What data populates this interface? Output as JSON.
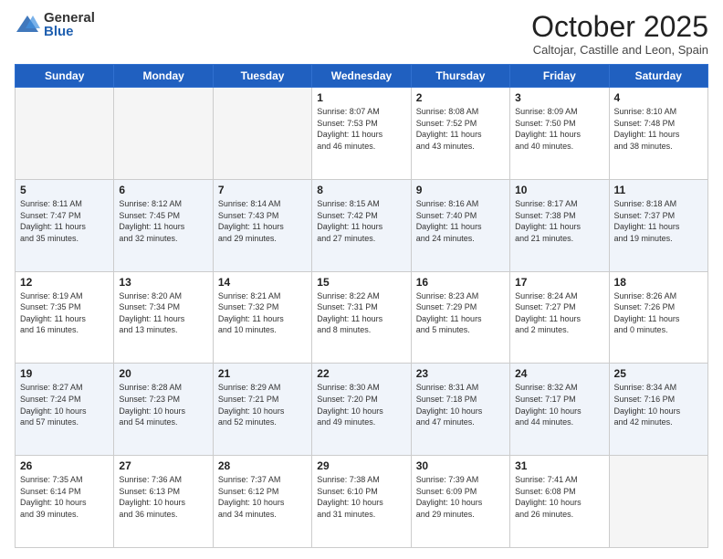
{
  "logo": {
    "general": "General",
    "blue": "Blue"
  },
  "header": {
    "month": "October 2025",
    "location": "Caltojar, Castille and Leon, Spain"
  },
  "days": [
    "Sunday",
    "Monday",
    "Tuesday",
    "Wednesday",
    "Thursday",
    "Friday",
    "Saturday"
  ],
  "weeks": [
    [
      {
        "day": "",
        "info": ""
      },
      {
        "day": "",
        "info": ""
      },
      {
        "day": "",
        "info": ""
      },
      {
        "day": "1",
        "info": "Sunrise: 8:07 AM\nSunset: 7:53 PM\nDaylight: 11 hours\nand 46 minutes."
      },
      {
        "day": "2",
        "info": "Sunrise: 8:08 AM\nSunset: 7:52 PM\nDaylight: 11 hours\nand 43 minutes."
      },
      {
        "day": "3",
        "info": "Sunrise: 8:09 AM\nSunset: 7:50 PM\nDaylight: 11 hours\nand 40 minutes."
      },
      {
        "day": "4",
        "info": "Sunrise: 8:10 AM\nSunset: 7:48 PM\nDaylight: 11 hours\nand 38 minutes."
      }
    ],
    [
      {
        "day": "5",
        "info": "Sunrise: 8:11 AM\nSunset: 7:47 PM\nDaylight: 11 hours\nand 35 minutes."
      },
      {
        "day": "6",
        "info": "Sunrise: 8:12 AM\nSunset: 7:45 PM\nDaylight: 11 hours\nand 32 minutes."
      },
      {
        "day": "7",
        "info": "Sunrise: 8:14 AM\nSunset: 7:43 PM\nDaylight: 11 hours\nand 29 minutes."
      },
      {
        "day": "8",
        "info": "Sunrise: 8:15 AM\nSunset: 7:42 PM\nDaylight: 11 hours\nand 27 minutes."
      },
      {
        "day": "9",
        "info": "Sunrise: 8:16 AM\nSunset: 7:40 PM\nDaylight: 11 hours\nand 24 minutes."
      },
      {
        "day": "10",
        "info": "Sunrise: 8:17 AM\nSunset: 7:38 PM\nDaylight: 11 hours\nand 21 minutes."
      },
      {
        "day": "11",
        "info": "Sunrise: 8:18 AM\nSunset: 7:37 PM\nDaylight: 11 hours\nand 19 minutes."
      }
    ],
    [
      {
        "day": "12",
        "info": "Sunrise: 8:19 AM\nSunset: 7:35 PM\nDaylight: 11 hours\nand 16 minutes."
      },
      {
        "day": "13",
        "info": "Sunrise: 8:20 AM\nSunset: 7:34 PM\nDaylight: 11 hours\nand 13 minutes."
      },
      {
        "day": "14",
        "info": "Sunrise: 8:21 AM\nSunset: 7:32 PM\nDaylight: 11 hours\nand 10 minutes."
      },
      {
        "day": "15",
        "info": "Sunrise: 8:22 AM\nSunset: 7:31 PM\nDaylight: 11 hours\nand 8 minutes."
      },
      {
        "day": "16",
        "info": "Sunrise: 8:23 AM\nSunset: 7:29 PM\nDaylight: 11 hours\nand 5 minutes."
      },
      {
        "day": "17",
        "info": "Sunrise: 8:24 AM\nSunset: 7:27 PM\nDaylight: 11 hours\nand 2 minutes."
      },
      {
        "day": "18",
        "info": "Sunrise: 8:26 AM\nSunset: 7:26 PM\nDaylight: 11 hours\nand 0 minutes."
      }
    ],
    [
      {
        "day": "19",
        "info": "Sunrise: 8:27 AM\nSunset: 7:24 PM\nDaylight: 10 hours\nand 57 minutes."
      },
      {
        "day": "20",
        "info": "Sunrise: 8:28 AM\nSunset: 7:23 PM\nDaylight: 10 hours\nand 54 minutes."
      },
      {
        "day": "21",
        "info": "Sunrise: 8:29 AM\nSunset: 7:21 PM\nDaylight: 10 hours\nand 52 minutes."
      },
      {
        "day": "22",
        "info": "Sunrise: 8:30 AM\nSunset: 7:20 PM\nDaylight: 10 hours\nand 49 minutes."
      },
      {
        "day": "23",
        "info": "Sunrise: 8:31 AM\nSunset: 7:18 PM\nDaylight: 10 hours\nand 47 minutes."
      },
      {
        "day": "24",
        "info": "Sunrise: 8:32 AM\nSunset: 7:17 PM\nDaylight: 10 hours\nand 44 minutes."
      },
      {
        "day": "25",
        "info": "Sunrise: 8:34 AM\nSunset: 7:16 PM\nDaylight: 10 hours\nand 42 minutes."
      }
    ],
    [
      {
        "day": "26",
        "info": "Sunrise: 7:35 AM\nSunset: 6:14 PM\nDaylight: 10 hours\nand 39 minutes."
      },
      {
        "day": "27",
        "info": "Sunrise: 7:36 AM\nSunset: 6:13 PM\nDaylight: 10 hours\nand 36 minutes."
      },
      {
        "day": "28",
        "info": "Sunrise: 7:37 AM\nSunset: 6:12 PM\nDaylight: 10 hours\nand 34 minutes."
      },
      {
        "day": "29",
        "info": "Sunrise: 7:38 AM\nSunset: 6:10 PM\nDaylight: 10 hours\nand 31 minutes."
      },
      {
        "day": "30",
        "info": "Sunrise: 7:39 AM\nSunset: 6:09 PM\nDaylight: 10 hours\nand 29 minutes."
      },
      {
        "day": "31",
        "info": "Sunrise: 7:41 AM\nSunset: 6:08 PM\nDaylight: 10 hours\nand 26 minutes."
      },
      {
        "day": "",
        "info": ""
      }
    ]
  ]
}
